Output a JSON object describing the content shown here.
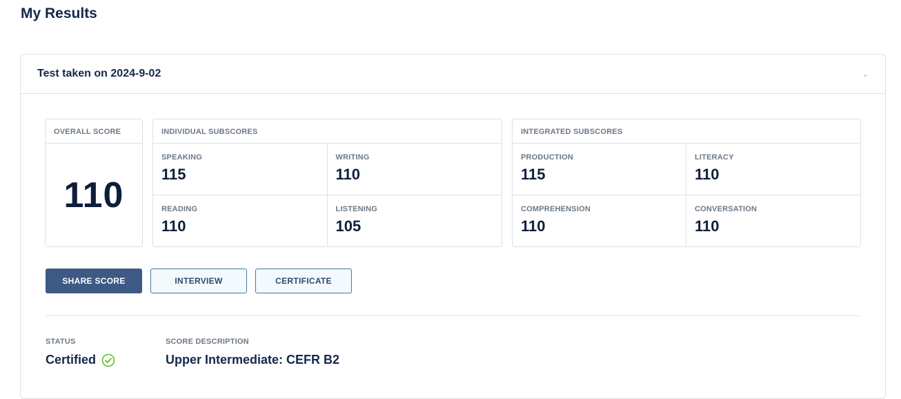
{
  "page": {
    "title": "My Results"
  },
  "test": {
    "header": "Test taken on 2024-9-02",
    "chevron": "⌄"
  },
  "overall": {
    "label": "OVERALL SCORE",
    "value": "110"
  },
  "individual": {
    "label": "INDIVIDUAL SUBSCORES",
    "items": [
      {
        "label": "SPEAKING",
        "value": "115"
      },
      {
        "label": "WRITING",
        "value": "110"
      },
      {
        "label": "READING",
        "value": "110"
      },
      {
        "label": "LISTENING",
        "value": "105"
      }
    ]
  },
  "integrated": {
    "label": "INTEGRATED SUBSCORES",
    "items": [
      {
        "label": "PRODUCTION",
        "value": "115"
      },
      {
        "label": "LITERACY",
        "value": "110"
      },
      {
        "label": "COMPREHENSION",
        "value": "110"
      },
      {
        "label": "CONVERSATION",
        "value": "110"
      }
    ]
  },
  "actions": {
    "share": "SHARE SCORE",
    "interview": "INTERVIEW",
    "certificate": "CERTIFICATE"
  },
  "status": {
    "label": "STATUS",
    "value": "Certified",
    "icon": "check-circle-icon",
    "icon_color": "#5cbf2a"
  },
  "description": {
    "label": "SCORE DESCRIPTION",
    "value": "Upper Intermediate: CEFR B2"
  },
  "colors": {
    "primary": "#3d5a85",
    "text": "#14284b",
    "border": "#dde1e6"
  }
}
